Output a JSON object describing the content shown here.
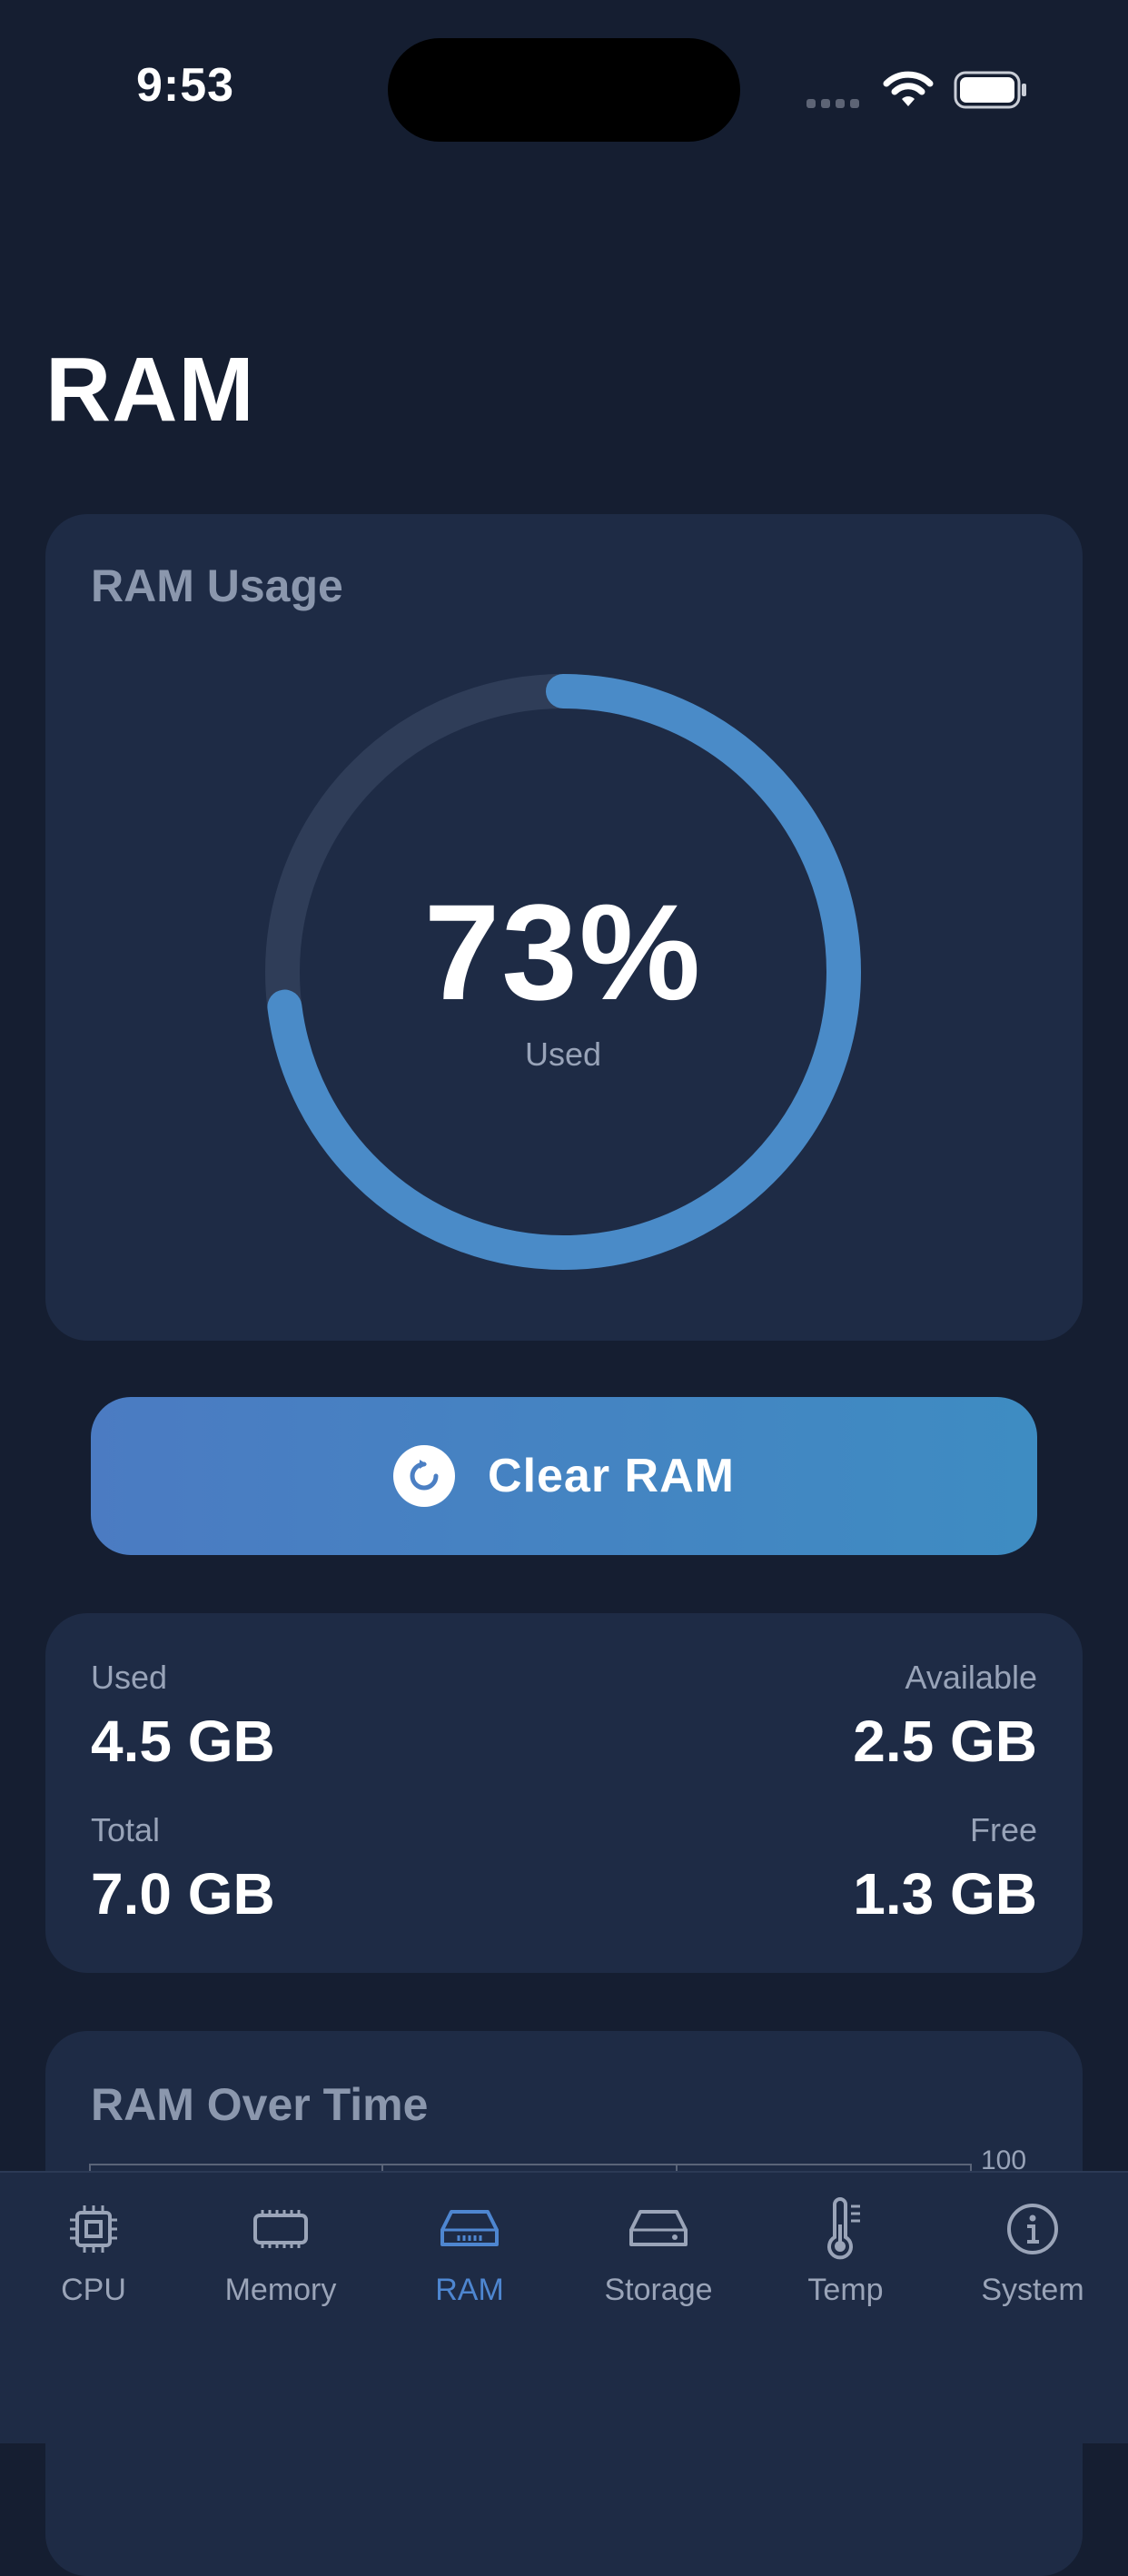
{
  "status_bar": {
    "time": "9:53"
  },
  "page": {
    "title": "RAM"
  },
  "usage_card": {
    "title": "RAM Usage",
    "percent_text": "73%",
    "percent_value": 73,
    "caption": "Used"
  },
  "clear_button": {
    "label": "Clear RAM"
  },
  "stats": {
    "used_label": "Used",
    "used_value": "4.5 GB",
    "available_label": "Available",
    "available_value": "2.5 GB",
    "total_label": "Total",
    "total_value": "7.0 GB",
    "free_label": "Free",
    "free_value": "1.3 GB"
  },
  "chart_card": {
    "title": "RAM Over Time",
    "y_max_label": "100"
  },
  "tabs": [
    {
      "label": "CPU",
      "icon": "cpu-icon"
    },
    {
      "label": "Memory",
      "icon": "memory-icon"
    },
    {
      "label": "RAM",
      "icon": "ram-icon",
      "active": true
    },
    {
      "label": "Storage",
      "icon": "storage-icon"
    },
    {
      "label": "Temp",
      "icon": "thermometer-icon"
    },
    {
      "label": "System",
      "icon": "info-icon"
    }
  ],
  "colors": {
    "accent": "#4e86d0",
    "background": "#151e31",
    "card": "#1e2b45"
  }
}
